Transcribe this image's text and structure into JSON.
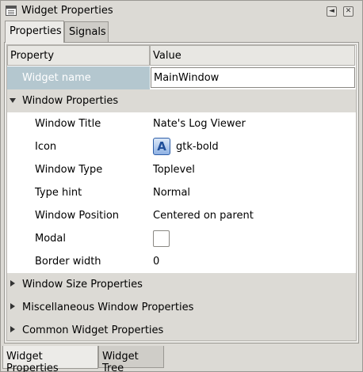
{
  "window": {
    "title": "Widget Properties"
  },
  "titlebar_buttons": {
    "detach": "◄",
    "close": "✕"
  },
  "tabs": {
    "properties": "Properties",
    "signals": "Signals"
  },
  "table": {
    "col_property": "Property",
    "col_value": "Value",
    "widget_name": {
      "label": "Widget name",
      "value": "MainWindow"
    },
    "window_properties": {
      "label": "Window Properties",
      "rows": [
        {
          "label": "Window Title",
          "value": "Nate's Log Viewer"
        },
        {
          "label": "Icon",
          "value": "gtk-bold",
          "icon_letter": "A"
        },
        {
          "label": "Window Type",
          "value": "Toplevel"
        },
        {
          "label": "Type hint",
          "value": "Normal"
        },
        {
          "label": "Window Position",
          "value": "Centered on parent"
        },
        {
          "label": "Modal",
          "value": ""
        },
        {
          "label": "Border width",
          "value": "0"
        }
      ]
    },
    "collapsed_sections": [
      "Window Size Properties",
      "Miscellaneous Window Properties",
      "Common Widget Properties"
    ]
  },
  "bottom_tabs": {
    "widget_properties": "Widget Properties",
    "widget_tree": "Widget Tree"
  },
  "colors": {
    "selected_row": "#b4c7cf",
    "section_bg": "#dcdad5",
    "window_bg": "#dcdad5"
  }
}
